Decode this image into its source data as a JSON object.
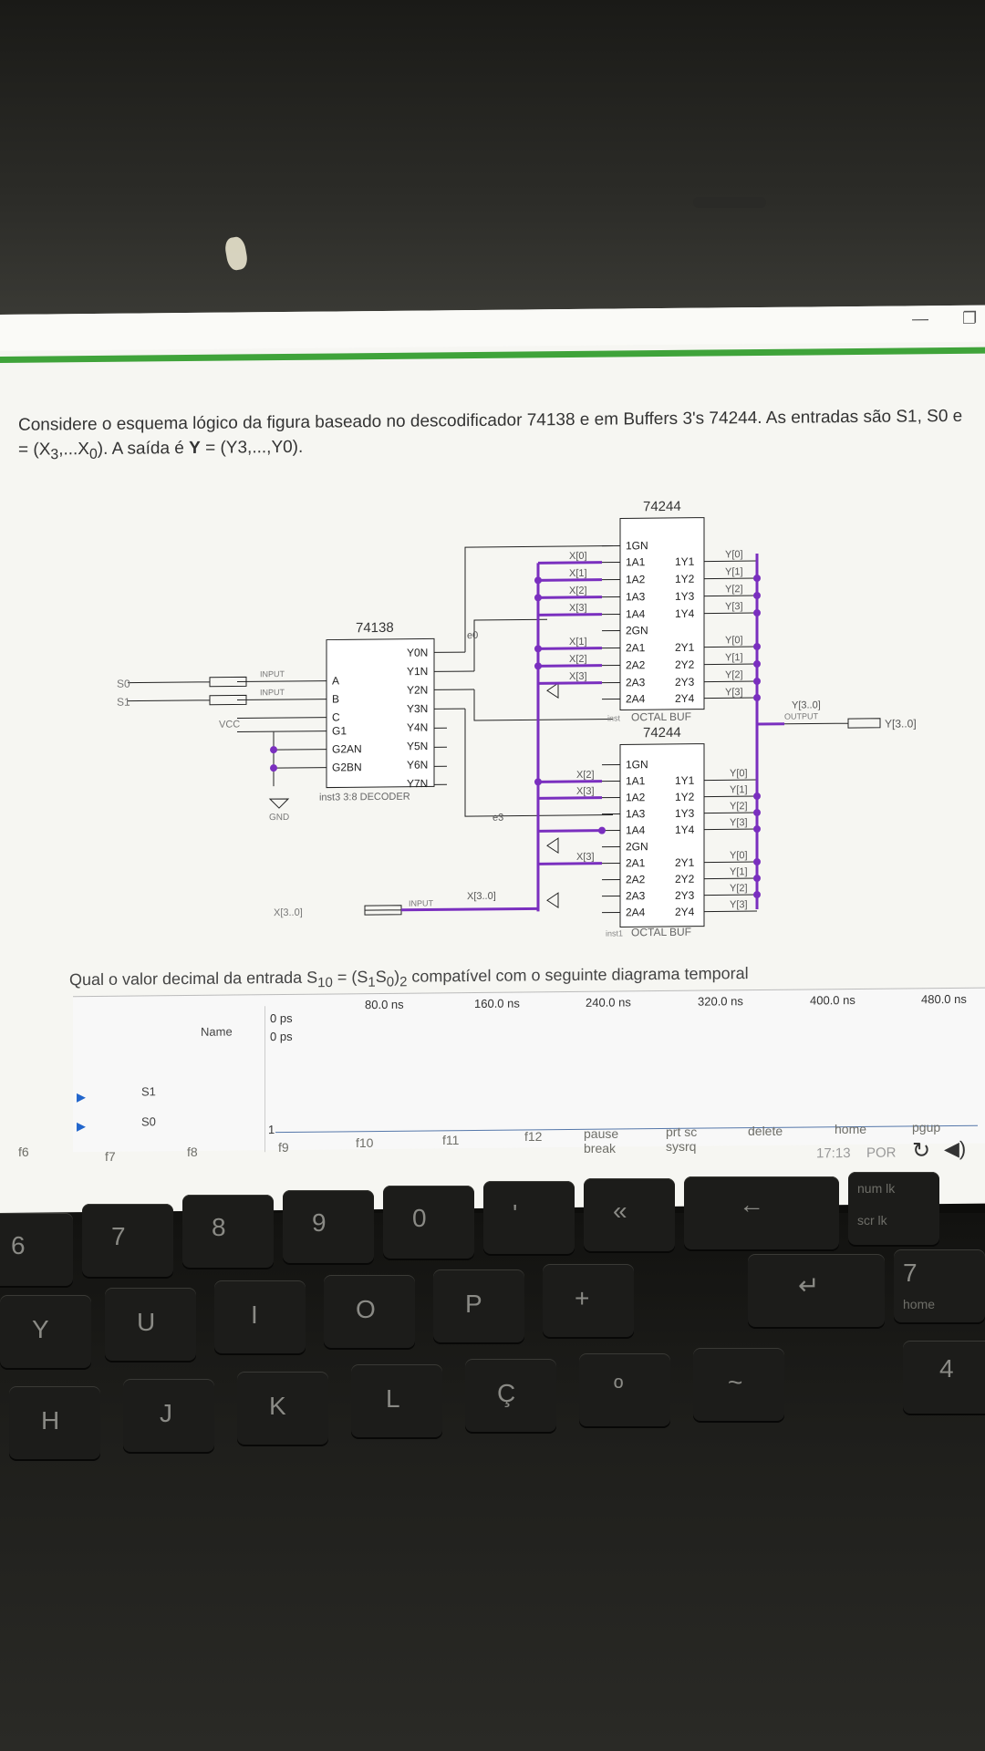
{
  "question": {
    "line1": "Considere o esquema lógico da figura baseado no descodificador 74138 e em Buffers 3's 74244. As entradas são S1, S0 e",
    "line2_pre": "= (X",
    "line2_sub1": "3",
    "line2_mid": ",...X",
    "line2_sub2": "0",
    "line2_post": "). A saída é ",
    "line2_bold": "Y",
    "line2_end": " = (Y3,...,Y0)."
  },
  "circuit": {
    "chip_74244_top": "74244",
    "chip_74244_bottom": "74244",
    "chip_74138": "74138",
    "decoder_caption": "inst3  3:8 DECODER",
    "octal_buf": "OCTAL BUF",
    "octal_buf_inst_top": "inst",
    "octal_buf_inst_bottom": "inst1",
    "decoder_pins_left": [
      "A",
      "B",
      "C",
      "G1",
      "G2AN",
      "G2BN"
    ],
    "decoder_pins_right": [
      "Y0N",
      "Y1N",
      "Y2N",
      "Y3N",
      "Y4N",
      "Y5N",
      "Y6N",
      "Y7N"
    ],
    "buf_pins_left": [
      "1GN",
      "1A1",
      "1A2",
      "1A3",
      "1A4",
      "2GN",
      "2A1",
      "2A2",
      "2A3",
      "2A4"
    ],
    "buf_pins_right": [
      "1Y1",
      "1Y2",
      "1Y3",
      "1Y4",
      "2Y1",
      "2Y2",
      "2Y3",
      "2Y4"
    ],
    "inputs": [
      "S0",
      "S1"
    ],
    "input_label": "INPUT",
    "vcc": "VCC",
    "gnd": "GND",
    "x_bus": "X[3..0]",
    "y_bus": "Y[3..0]",
    "output_label": "OUTPUT",
    "x_wires_top1": [
      "X[0]",
      "X[1]",
      "X[2]",
      "X[3]"
    ],
    "x_wires_top2": [
      "X[1]",
      "X[2]",
      "X[3]"
    ],
    "x_wires_bot1": [
      "X[2]",
      "X[3]"
    ],
    "x_wire_bot2": "X[3]",
    "y_wires_top1": [
      "Y[0]",
      "Y[1]",
      "Y[2]",
      "Y[3]"
    ],
    "y_wires_top2": [
      "Y[0]",
      "Y[1]",
      "Y[2]",
      "Y[3]"
    ],
    "y_wires_bot1": [
      "Y[0]",
      "Y[1]",
      "Y[2]",
      "Y[3]"
    ],
    "y_wires_bot2": [
      "Y[0]",
      "Y[1]",
      "Y[2]",
      "Y[3]"
    ],
    "net_e0": "e0",
    "net_e3": "e3"
  },
  "question2": {
    "pre": "Qual o valor decimal da entrada S",
    "sub": "10",
    "mid": " = (S",
    "sub1": "1",
    "s0": "S",
    "sub0": "0",
    "end": ")",
    "sub2": "2",
    "tail": " compatível com o seguinte diagrama temporal"
  },
  "timing": {
    "name_header": "Name",
    "ps_top": "0 ps",
    "ps_bottom": "0 ps",
    "ticks": [
      "80.0 ns",
      "160.0 ns",
      "240.0 ns",
      "320.0 ns",
      "400.0 ns",
      "480.0 ns"
    ],
    "signals": [
      "S1",
      "S0"
    ],
    "s0_level": "1"
  },
  "taskbar": {
    "clock": "17:13",
    "lang": "POR"
  },
  "keyboard": {
    "fn_row": [
      "f6",
      "f7",
      "f8",
      "f9",
      "f10",
      "f11",
      "f12",
      "pause\nbreak",
      "prt sc\nsysrq",
      "delete",
      "home",
      "pgup"
    ],
    "num_row": [
      "6",
      "7",
      "8",
      "9",
      "0",
      "'",
      "«"
    ],
    "top_row": [
      "Y",
      "U",
      "I",
      "O",
      "P",
      "+"
    ],
    "home_row": [
      "H",
      "J",
      "K",
      "L",
      "Ç",
      "º",
      "~"
    ],
    "numpad": [
      "num lk",
      "scr lk",
      "7",
      "home",
      "4"
    ]
  },
  "colors": {
    "wire": "#7a2fbf",
    "accent": "#3fa33a",
    "box": "#ffffff"
  }
}
